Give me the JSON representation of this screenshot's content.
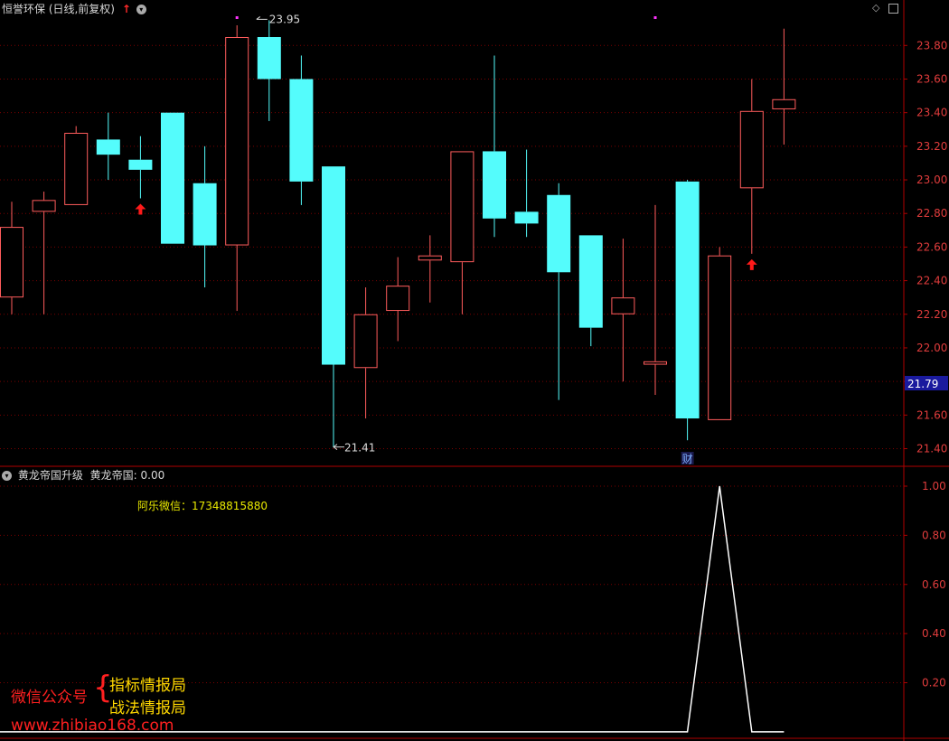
{
  "header": {
    "title": "恒誉环保 (日线,前复权)",
    "indicator_name": "黄龙帝国升级",
    "indicator_value_label": "黄龙帝国: 0.00"
  },
  "annotations": {
    "contact": "阿乐微信：17348815880",
    "high_label": "23.95",
    "low_label": "21.41",
    "finance_marker": "财"
  },
  "watermark": {
    "prefix": "微信公众号",
    "line1": "指标情报局",
    "line2": "战法情报局",
    "url": "www.zhibiao168.com"
  },
  "chart_data": [
    {
      "type": "candlestick",
      "ylim": [
        21.3,
        23.95
      ],
      "y_ticks": [
        "23.80",
        "23.60",
        "23.40",
        "23.20",
        "23.00",
        "22.80",
        "22.60",
        "22.40",
        "22.20",
        "22.00",
        "21.80",
        "21.60",
        "21.40"
      ],
      "current_price": "21.79",
      "candles": [
        {
          "o": 22.3,
          "h": 22.87,
          "l": 22.2,
          "c": 22.72
        },
        {
          "o": 22.81,
          "h": 22.93,
          "l": 22.2,
          "c": 22.88
        },
        {
          "o": 22.85,
          "h": 23.32,
          "l": 22.85,
          "c": 23.28
        },
        {
          "o": 23.24,
          "h": 23.4,
          "l": 23.0,
          "c": 23.15
        },
        {
          "o": 23.12,
          "h": 23.26,
          "l": 22.89,
          "c": 23.06
        },
        {
          "o": 23.4,
          "h": 23.4,
          "l": 22.62,
          "c": 22.62
        },
        {
          "o": 22.98,
          "h": 23.2,
          "l": 22.36,
          "c": 22.61
        },
        {
          "o": 22.61,
          "h": 23.92,
          "l": 22.22,
          "c": 23.85
        },
        {
          "o": 23.85,
          "h": 23.95,
          "l": 23.35,
          "c": 23.6
        },
        {
          "o": 23.6,
          "h": 23.74,
          "l": 22.85,
          "c": 22.99
        },
        {
          "o": 23.08,
          "h": 23.08,
          "l": 21.41,
          "c": 21.9
        },
        {
          "o": 21.88,
          "h": 22.36,
          "l": 21.58,
          "c": 22.2
        },
        {
          "o": 22.22,
          "h": 22.54,
          "l": 22.04,
          "c": 22.37
        },
        {
          "o": 22.52,
          "h": 22.67,
          "l": 22.27,
          "c": 22.55
        },
        {
          "o": 22.51,
          "h": 23.17,
          "l": 22.2,
          "c": 23.17
        },
        {
          "o": 23.17,
          "h": 23.74,
          "l": 22.66,
          "c": 22.77
        },
        {
          "o": 22.81,
          "h": 23.18,
          "l": 22.66,
          "c": 22.74
        },
        {
          "o": 22.91,
          "h": 22.98,
          "l": 21.69,
          "c": 22.45
        },
        {
          "o": 22.67,
          "h": 22.67,
          "l": 22.01,
          "c": 22.12
        },
        {
          "o": 22.2,
          "h": 22.65,
          "l": 21.8,
          "c": 22.3
        },
        {
          "o": 21.9,
          "h": 22.85,
          "l": 21.72,
          "c": 21.92
        },
        {
          "o": 22.99,
          "h": 23.0,
          "l": 21.45,
          "c": 21.58
        },
        {
          "o": 21.57,
          "h": 22.6,
          "l": 21.57,
          "c": 22.55
        },
        {
          "o": 22.95,
          "h": 23.6,
          "l": 22.56,
          "c": 23.41
        },
        {
          "o": 23.42,
          "h": 23.9,
          "l": 23.21,
          "c": 23.48
        }
      ],
      "buy_arrows": [
        4,
        23
      ],
      "top_markers": [
        7,
        20
      ]
    },
    {
      "type": "line",
      "series": [
        {
          "values": [
            0,
            0,
            0,
            0,
            0,
            0,
            0,
            0,
            0,
            0,
            0,
            0,
            0,
            0,
            0,
            0,
            0,
            0,
            0,
            0,
            0,
            0,
            1,
            0,
            0
          ]
        }
      ],
      "ylim": [
        0,
        1.05
      ],
      "y_ticks": [
        "1.00",
        "0.80",
        "0.60",
        "0.40",
        "0.20"
      ]
    }
  ],
  "colors": {
    "up": "#ff5c5c",
    "down": "#54fcfc",
    "grid": "#7a0000",
    "axis": "#b00000",
    "axis_text": "#e03c3c",
    "line": "#ffffff",
    "contact": "#e8e800",
    "watermark_red": "#ff2020",
    "watermark_yellow": "#ffd800"
  }
}
